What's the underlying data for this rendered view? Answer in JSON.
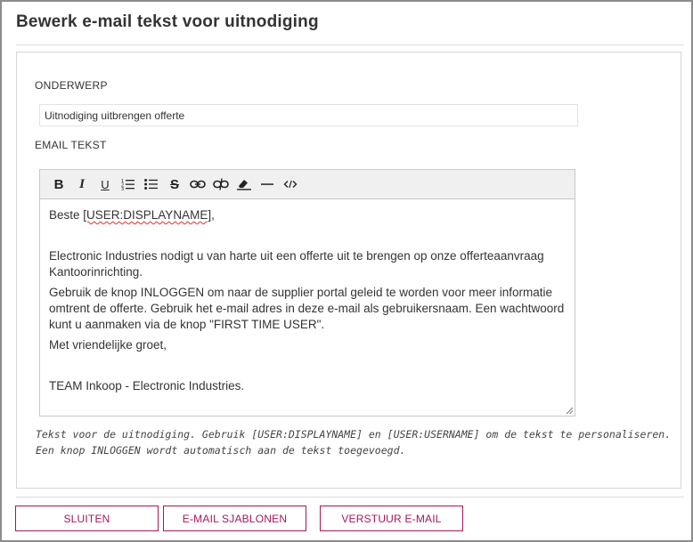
{
  "dialog": {
    "title": "Bewerk e-mail tekst voor uitnodiging"
  },
  "form": {
    "subject_label": "ONDERWERP",
    "subject_value": "Uitnodiging uitbrengen offerte",
    "body_label": "EMAIL TEKST"
  },
  "toolbar": {
    "bold": "B",
    "italic": "I",
    "underline": "U",
    "strikethrough": "S",
    "icons": [
      "bold-icon",
      "italic-icon",
      "underline-icon",
      "ordered-list-icon",
      "bullet-list-icon",
      "strikethrough-icon",
      "link-icon",
      "unlink-icon",
      "clear-format-icon",
      "horizontal-rule-icon",
      "code-icon"
    ]
  },
  "editor": {
    "greeting_prefix": "Beste ",
    "greeting_token": "[USER:DISPLAYNAME]",
    "greeting_suffix": ",",
    "para1": "Electronic Industries nodigt u van harte uit een offerte uit te brengen op onze offerteaanvraag Kantoorinrichting.",
    "para2": "Gebruik de knop INLOGGEN om naar de supplier portal geleid te worden voor meer informatie omtrent de offerte. Gebruik het e-mail adres in deze e-mail als gebruikersnaam. Een wachtwoord kunt u aanmaken via de knop \"FIRST TIME USER\".",
    "para3": "Met vriendelijke groet,",
    "signature": "TEAM Inkoop - Electronic Industries."
  },
  "help": {
    "line1": "Tekst voor de uitnodiging. Gebruik [USER:DISPLAYNAME] en [USER:USERNAME] om de tekst te personaliseren.",
    "line2": "Een knop INLOGGEN wordt automatisch aan de tekst toegevoegd."
  },
  "buttons": {
    "close": "SLUITEN",
    "templates": "E-MAIL SJABLONEN",
    "send": "VERSTUUR E-MAIL"
  },
  "colors": {
    "accent": "#a5175c",
    "border": "#8c8c8c"
  }
}
